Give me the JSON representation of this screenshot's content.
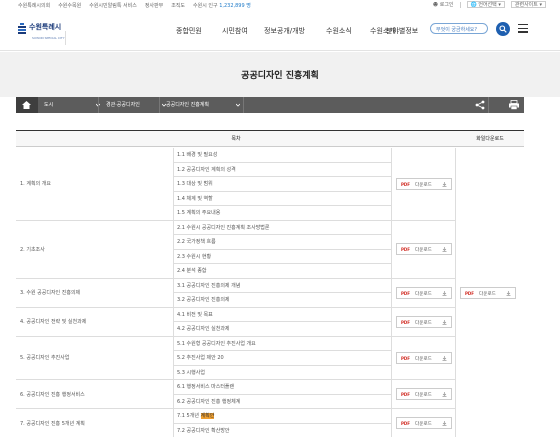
{
  "util": {
    "links": [
      "수원특례시의회",
      "수원수목원",
      "수원시민알림톡 서비스",
      "정사판부",
      "조직도"
    ],
    "population_label": "수원시 인구",
    "population_value": "1,232,899 명",
    "login": "로그인",
    "language": "언어선택",
    "related": "관련사이트"
  },
  "header": {
    "logo_name": "수원특례시",
    "logo_sub": "SUWON SPECIAL CITY",
    "nav": [
      "종합민원",
      "시민참여",
      "정보공개/개방",
      "수원소식",
      "수원소개",
      "분야별정보"
    ],
    "search_placeholder": "무엇이 궁금하세요?"
  },
  "page": {
    "title": "공공디자인 진흥계획"
  },
  "breadcrumb": [
    "도시",
    "경관·공공디자인",
    "공공디자인 진흥계획"
  ],
  "table": {
    "headers": {
      "contents": "목차",
      "download": "화일다운로드"
    },
    "download_label": "다운로드",
    "pdf_label": "PDF",
    "rows": [
      {
        "group": "1. 계획의 개요",
        "items": [
          "1.1 배경 및 필요성",
          "1.2 공공디자인 계획의 성격",
          "1.3 대상 및 범위",
          "1.4 체계 및 역할",
          "1.5 계획의 주요내용"
        ]
      },
      {
        "group": "2. 기초조사",
        "items": [
          "2.1 수원시 공공디자인 진흥계획 조사방법론",
          "2.2 국가정책 흐름",
          "2.3 수원시 현황",
          "2.4 분석 종합"
        ]
      },
      {
        "group": "3. 수원 공공디자인 진흥의제",
        "items": [
          "3.1 공공디자인 진흥의제 개념",
          "3.2 공공디자인 진흥의제"
        ]
      },
      {
        "group": "4. 공공디자인 전략 및 실천과제",
        "items": [
          "4.1 비전 및 목표",
          "4.2 공공디자인 실천과제"
        ]
      },
      {
        "group": "5. 공공디자인 추진사업",
        "items": [
          "5.1 수원형 공공디자인 추진사업 개요",
          "5.2 추진사업 제안 20",
          "5.3 시행사업"
        ]
      },
      {
        "group": "6. 공공디자인 진흥 행정서비스",
        "items": [
          "6.1 행정서비스 마스터플랜",
          "6.2 공공디자인 진흥 행정체계"
        ]
      },
      {
        "group": "7. 공공디자인 진흥 5개년 계획",
        "items": [
          "7.1 5개년 ",
          "7.2 공공디자인 확산방안"
        ],
        "highlight": "계획안"
      }
    ]
  }
}
